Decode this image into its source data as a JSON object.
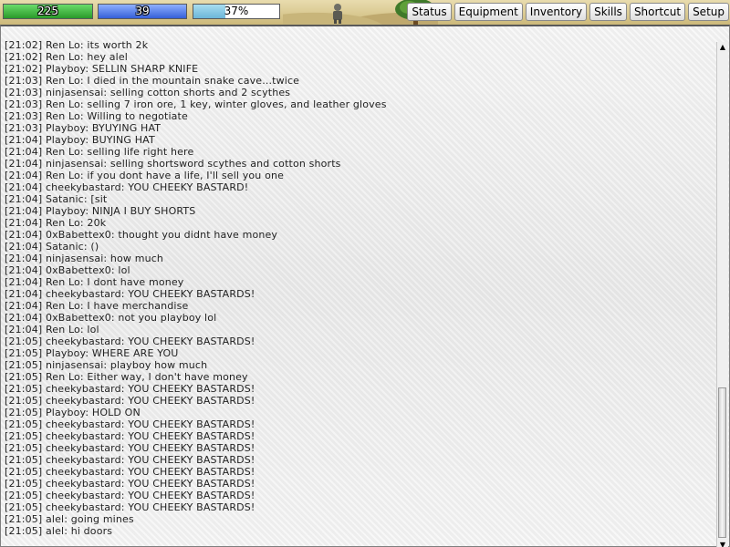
{
  "hud": {
    "hp": {
      "label": "225",
      "fraction": 1.0,
      "color": "#2a9a2a"
    },
    "mp": {
      "label": "39",
      "fraction": 1.0,
      "color": "#3560d8"
    },
    "xp": {
      "label": "37%",
      "fraction": 0.37,
      "color": "#6cb6d8"
    }
  },
  "menu": {
    "items": [
      {
        "label": "Status"
      },
      {
        "label": "Equipment"
      },
      {
        "label": "Inventory"
      },
      {
        "label": "Skills"
      },
      {
        "label": "Shortcut"
      },
      {
        "label": "Setup"
      }
    ]
  },
  "chat": {
    "lines": [
      "[21:02] Ren Lo: its worth 2k",
      "[21:02] Ren Lo: hey alel",
      "[21:02] Playboy: SELLIN SHARP KNIFE",
      "[21:03] Ren Lo: I died in the mountain snake cave...twice",
      "[21:03] ninjasensai: selling cotton shorts and 2 scythes",
      "[21:03] Ren Lo: selling 7 iron ore, 1 key, winter gloves, and leather gloves",
      "[21:03] Ren Lo: Willing to negotiate",
      "[21:03] Playboy: BYUYING HAT",
      "[21:04] Playboy: BUYING HAT",
      "[21:04] Ren Lo: selling life right here",
      "[21:04] ninjasensai: selling shortsword scythes and cotton shorts",
      "[21:04] Ren Lo: if you dont have a life, I'll sell you one",
      "[21:04] cheekybastard: YOU CHEEKY BASTARD!",
      "[21:04] Satanic: [sit",
      "[21:04] Playboy: NINJA I BUY SHORTS",
      "[21:04] Ren Lo: 20k",
      "[21:04] 0xBabettex0: thought you didnt have money",
      "[21:04] Satanic: ()",
      "[21:04] ninjasensai: how much",
      "[21:04] 0xBabettex0: lol",
      "[21:04] Ren Lo: I dont have money",
      "[21:04] cheekybastard: YOU CHEEKY BASTARDS!",
      "[21:04] Ren Lo: I have merchandise",
      "[21:04] 0xBabettex0: not you playboy lol",
      "[21:04] Ren Lo: lol",
      "[21:05] cheekybastard: YOU CHEEKY BASTARDS!",
      "[21:05] Playboy: WHERE ARE YOU",
      "[21:05] ninjasensai: playboy how much",
      "[21:05] Ren Lo: Either way, I don't have money",
      "[21:05] cheekybastard: YOU CHEEKY BASTARDS!",
      "[21:05] cheekybastard: YOU CHEEKY BASTARDS!",
      "[21:05] Playboy: HOLD ON",
      "[21:05] cheekybastard: YOU CHEEKY BASTARDS!",
      "[21:05] cheekybastard: YOU CHEEKY BASTARDS!",
      "[21:05] cheekybastard: YOU CHEEKY BASTARDS!",
      "[21:05] cheekybastard: YOU CHEEKY BASTARDS!",
      "[21:05] cheekybastard: YOU CHEEKY BASTARDS!",
      "[21:05] cheekybastard: YOU CHEEKY BASTARDS!",
      "[21:05] cheekybastard: YOU CHEEKY BASTARDS!",
      "[21:05] cheekybastard: YOU CHEEKY BASTARDS!",
      "[21:05] alel: going mines",
      "[21:05] alel: hi doors"
    ]
  },
  "scroll": {
    "position": 0.72,
    "visible_fraction": 0.3
  },
  "icons": {
    "scroll_up": "arrow-up-icon",
    "scroll_down": "arrow-down-icon",
    "player_sprite": "player-sprite-icon",
    "tree": "tree-icon"
  }
}
